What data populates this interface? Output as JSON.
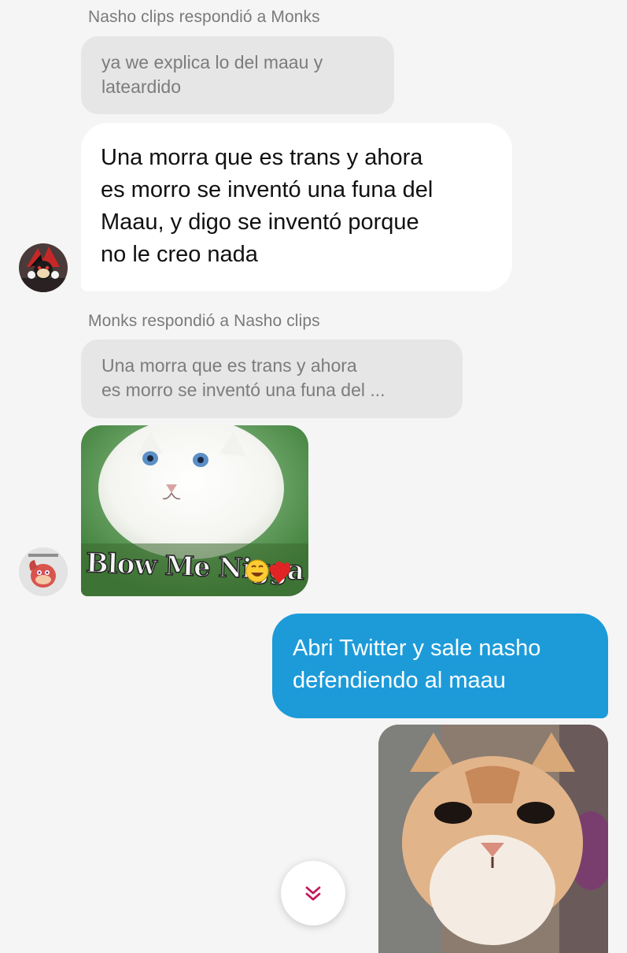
{
  "thread": {
    "msg1": {
      "reply_meta": "Nasho clips respondió a Monks",
      "quote_line1": "ya we explica lo del maau y",
      "quote_line2": "lateardido",
      "text_line1": "Una morra que es trans y ahora",
      "text_line2": "es morro se inventó una funa del",
      "text_line3": "Maau, y digo se inventó porque",
      "text_line4": "no le creo nada"
    },
    "msg2": {
      "reply_meta": "Monks respondió a Nasho clips",
      "quote_line1": "Una morra que es trans y ahora",
      "quote_line2": "es morro se inventó una funa del ...",
      "image_caption": "Blow Me Nigga"
    },
    "msg3": {
      "text_line1": "Abri Twitter y sale nasho",
      "text_line2": "defendiendo al maau"
    }
  },
  "icons": {
    "scroll_down": "chevron-double-down-icon"
  },
  "colors": {
    "background": "#f5f5f5",
    "incoming_bubble": "#ffffff",
    "outgoing_bubble": "#1d9bd9",
    "quote_bubble": "#e6e6e6",
    "meta_text": "#7a7a7a",
    "scroll_chevron": "#c2185b"
  }
}
